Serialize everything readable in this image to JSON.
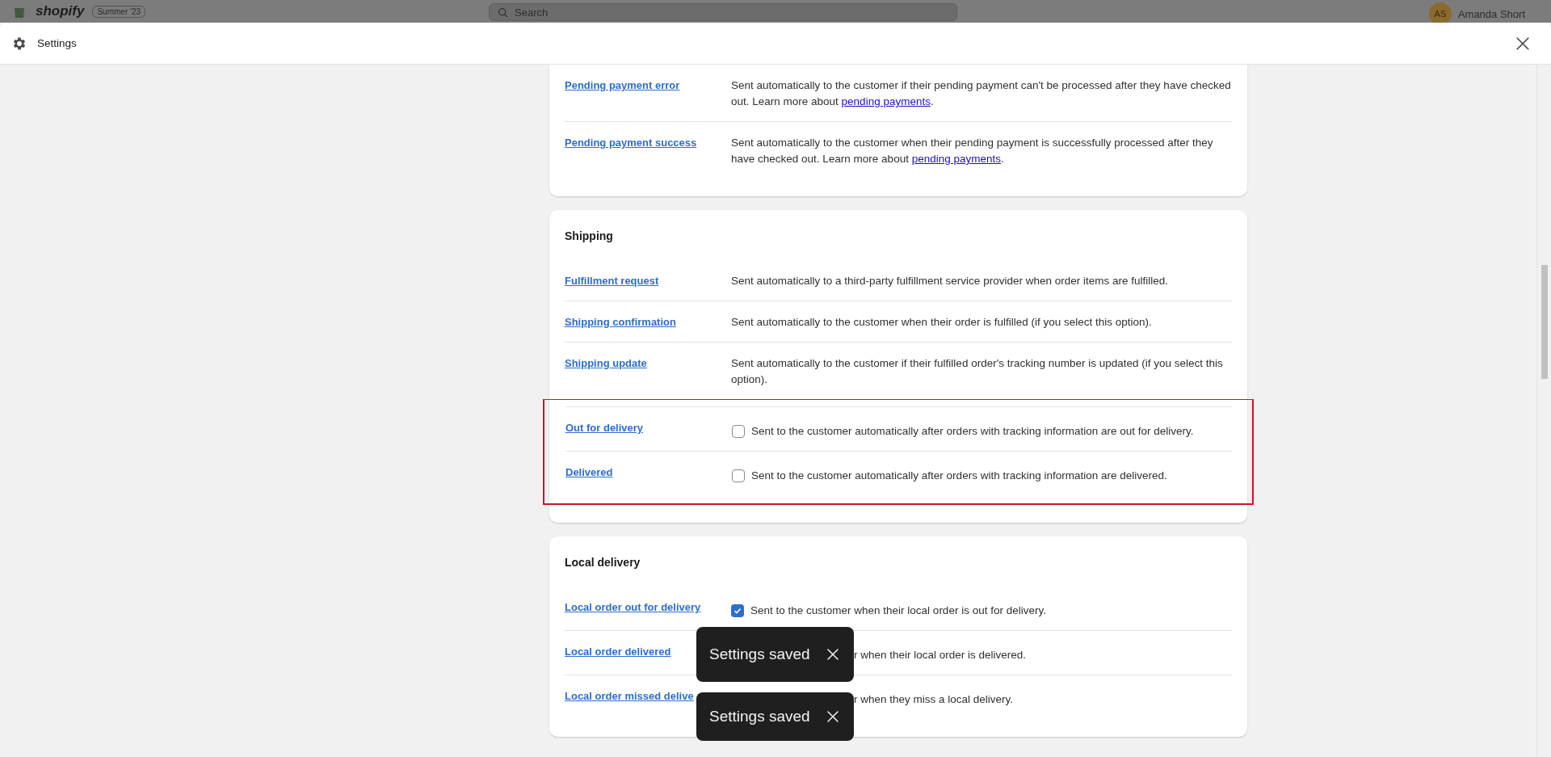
{
  "topbar": {
    "logo": "shopify",
    "badge": "Summer '23",
    "search": {
      "placeholder": "Search"
    },
    "user": {
      "initials": "AS",
      "name": "Amanda Short"
    }
  },
  "modal": {
    "title": "Settings"
  },
  "sections": [
    {
      "rows": [
        {
          "kind": "text",
          "name": "Pending payment error",
          "description": "Sent automatically to the customer if their pending payment can't be processed after they have checked out. Learn more about ",
          "link": "pending payments",
          "after": "."
        },
        {
          "kind": "text",
          "name": "Pending payment success",
          "description": "Sent automatically to the customer when their pending payment is successfully processed after they have checked out. Learn more about ",
          "link": "pending payments",
          "after": "."
        }
      ]
    },
    {
      "title": "Shipping",
      "rows": [
        {
          "kind": "text",
          "name": "Fulfillment request",
          "description": "Sent automatically to a third-party fulfillment service provider when order items are fulfilled."
        },
        {
          "kind": "text",
          "name": "Shipping confirmation",
          "description": "Sent automatically to the customer when their order is fulfilled (if you select this option)."
        },
        {
          "kind": "text",
          "name": "Shipping update",
          "description": "Sent automatically to the customer if their fulfilled order's tracking number is updated (if you select this option)."
        },
        {
          "kind": "checkbox",
          "highlighted": true,
          "checked": false,
          "name": "Out for delivery",
          "description": "Sent to the customer automatically after orders with tracking information are out for delivery."
        },
        {
          "kind": "checkbox",
          "highlighted": true,
          "checked": false,
          "name": "Delivered",
          "description": "Sent to the customer automatically after orders with tracking information are delivered."
        }
      ]
    },
    {
      "title": "Local delivery",
      "rows": [
        {
          "kind": "checkbox",
          "checked": true,
          "name": "Local order out for delivery",
          "description": "Sent to the customer when their local order is out for delivery."
        },
        {
          "kind": "checkbox",
          "covered": true,
          "name": "Local order delivered",
          "description": "r when their local order is delivered."
        },
        {
          "kind": "checkbox",
          "covered": true,
          "name": "Local order missed delive",
          "description": "r when they miss a local delivery."
        }
      ]
    }
  ],
  "toasts": [
    {
      "text": "Settings saved"
    },
    {
      "text": "Settings saved"
    }
  ]
}
